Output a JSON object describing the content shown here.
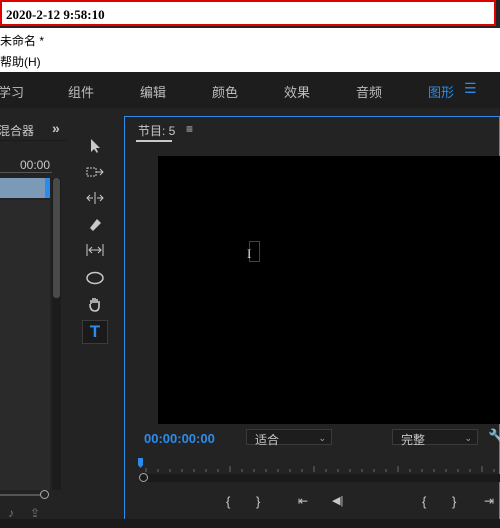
{
  "window": {
    "title": "2020-2-12 9:58:10",
    "project_name": "未命名 *",
    "help_menu": "帮助(H)"
  },
  "workspaces": [
    {
      "label": "学习",
      "active": false
    },
    {
      "label": "组件",
      "active": false
    },
    {
      "label": "编辑",
      "active": false
    },
    {
      "label": "颜色",
      "active": false
    },
    {
      "label": "效果",
      "active": false
    },
    {
      "label": "音频",
      "active": false
    },
    {
      "label": "图形",
      "active": true
    }
  ],
  "left_panel": {
    "tab_label": "混合器",
    "timecode": "00:00"
  },
  "program_monitor": {
    "title": "节目: 5",
    "timecode": "00:00:00:00",
    "fit": "适合",
    "quality": "完整"
  },
  "colors": {
    "accent": "#2d8ceb",
    "panel_bg": "#232323",
    "highlight_red": "#e00000"
  }
}
